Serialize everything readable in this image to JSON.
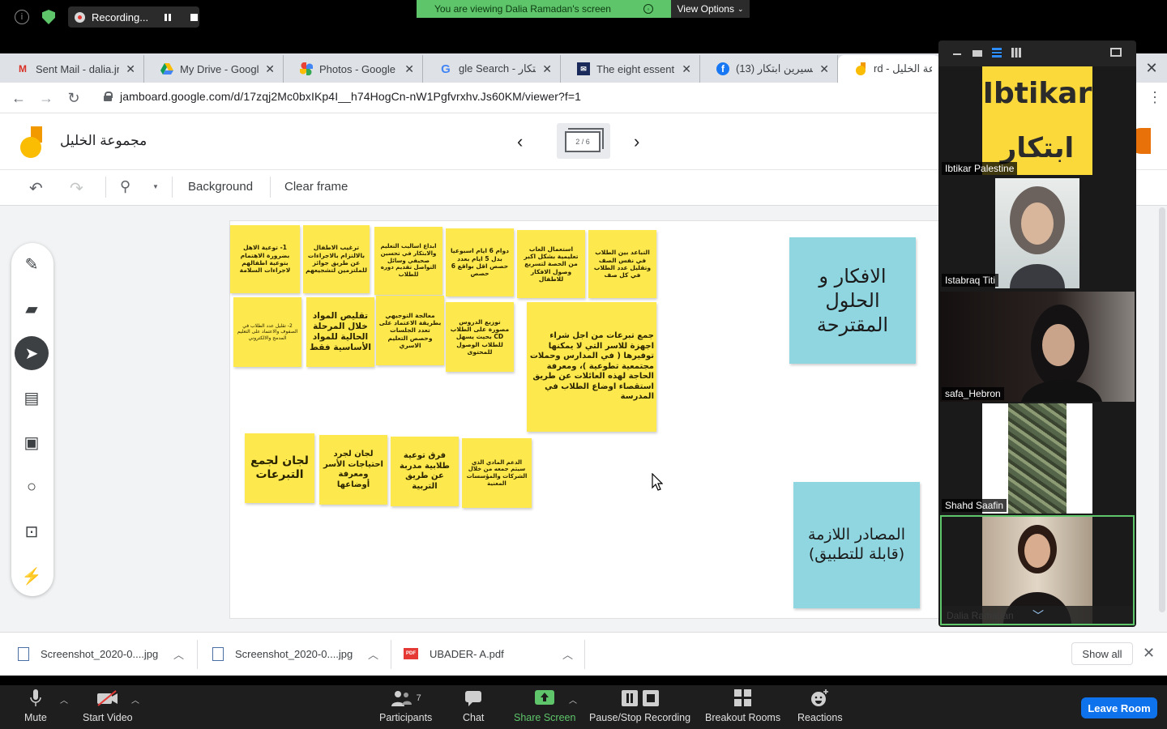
{
  "zoom_top": {
    "recording_label": "Recording...",
    "viewing_label": "You are viewing Dalia Ramadan's screen",
    "view_options_label": "View Options"
  },
  "tabs": [
    {
      "title": "Sent Mail - dalia.jr",
      "icon": "gmail-icon"
    },
    {
      "title": "My Drive - Google",
      "icon": "drive-icon"
    },
    {
      "title": "Photos - Google P",
      "icon": "photos-icon"
    },
    {
      "title": "gle Search - الابتكار",
      "icon": "google-icon"
    },
    {
      "title": "The eight essentia",
      "icon": "mail-icon"
    },
    {
      "title": "(13) ميسيرين ابتكار",
      "icon": "facebook-icon"
    },
    {
      "title": "rd - مجموعة الخليل",
      "icon": "jamboard-icon"
    }
  ],
  "address": {
    "url": "jamboard.google.com/d/17zqj2Mc0bxIKp4I__h74HogCn-nW1Pgfvrxhv.Js60KM/viewer?f=1"
  },
  "jamboard": {
    "title": "مجموعة الخليل",
    "frame_counter": "2 / 6",
    "toolbar": {
      "background_label": "Background",
      "clear_frame_label": "Clear frame"
    },
    "notes_top_row": [
      "1- توعية الاهل بضرورة الاهتمام بتوعية اطفالهم لاجراءات السلامة",
      "ترغيب الاطفال بالالتزام بالاجراءات عن طريق جوائز للملتزمين لتشجيعهم",
      "ابداع اساليب التعليم والابتكار في تحسين صحيفي وسائل التواصل تقديم دوره للطلاب",
      "دوام 6 ايام اسبوعيا بدل 5 ايام بعدد حصص اقل بواقع 6 حصص",
      "استعمال العاب تعليمية بشكل اكبر من الحصة لتسريع وصول الافكار للاطفال",
      "التباعد بين الطلاب في نفس الصف وتقليل عدد الطلاب في كل صف"
    ],
    "notes_mid_row": [
      "2- تقليل عدد الطلاب في الصفوف والاعتماد على التعليم المدمج والالكتروني",
      "تقليص المواد خلال المرحلة الحالية للمواد الأساسية فقط",
      "معالجة التوجيهي بطريقة الاعتماد على تعدد الجلسات وحصص التعليم الاسري",
      "توزيع الدروس مصورة على الطلاب CD بحيث يسهل للطلاب الوصول للمحتوى",
      "جمع تبرعات من اجل شراء اجهزة للاسر التي لا يمكنها توفيرها ( في المدارس وحملات مجتمعية تطوعية )، ومعرفة الحاجة لهذه العائلات عن طريق استقصاء اوضاع الطلاب في المدرسة"
    ],
    "notes_bottom_row": [
      "لجان لجمع التبرعات",
      "لجان لجرد احتياجات الأسر ومعرفة أوضاعها",
      "فرق توعية طلابية مدربة عن طريق التربية",
      "الدعم المادي الذي سيتم جمعه من خلال الشركات والمؤسسات المعنية"
    ],
    "blue_notes": [
      "الافكار و الحلول المقترحة",
      "المصادر اللازمة (قابلة للتطبيق)"
    ]
  },
  "participants": [
    {
      "name": "Ibtikar Palestine",
      "logo_text_en": "Ibtikar",
      "logo_text_ar": "ابتكار"
    },
    {
      "name": "Istabraq Titi"
    },
    {
      "name": "safa_Hebron"
    },
    {
      "name": "Shahd Saafin"
    },
    {
      "name": "Dalia Ramadan"
    }
  ],
  "downloads": [
    {
      "name": "Screenshot_2020-0....jpg",
      "icon": "image-file-icon"
    },
    {
      "name": "Screenshot_2020-0....jpg",
      "icon": "image-file-icon"
    },
    {
      "name": "UBADER- A.pdf",
      "icon": "pdf-file-icon"
    }
  ],
  "downloads_show_all": "Show all",
  "zoom_bottom": {
    "mute": "Mute",
    "start_video": "Start Video",
    "participants": "Participants",
    "participants_count": "7",
    "chat": "Chat",
    "share_screen": "Share Screen",
    "pause_recording": "Pause/Stop Recording",
    "breakout_rooms": "Breakout Rooms",
    "reactions": "Reactions",
    "leave_room": "Leave Room"
  },
  "colors": {
    "zoom_green": "#5ec56a",
    "sticky_yellow": "#fde84d",
    "sticky_blue": "#8fd6e1",
    "leave_blue": "#0e72ed",
    "ibtikar_yellow": "#fbd93a"
  }
}
